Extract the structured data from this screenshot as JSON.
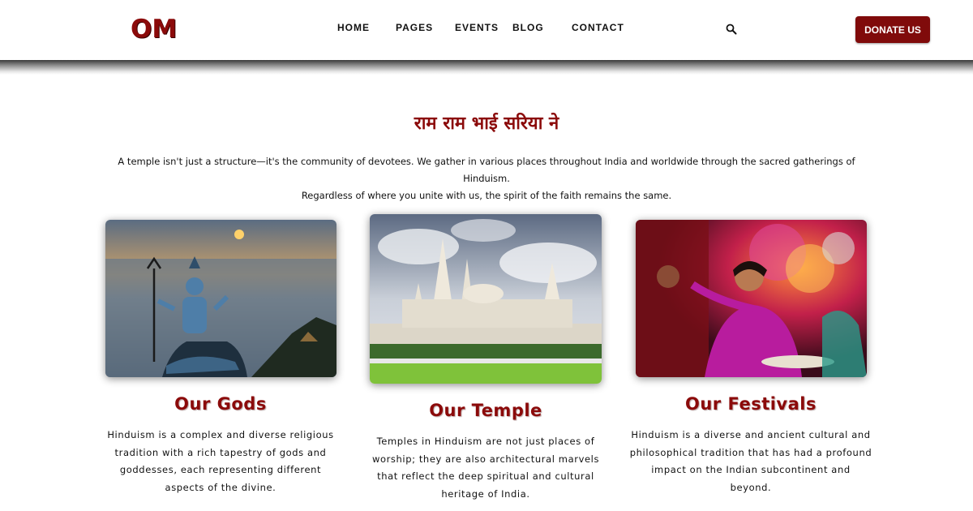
{
  "header": {
    "logo": "OM",
    "nav": [
      "HOME",
      "PAGES",
      "EVENTS",
      "BLOG",
      "CONTACT"
    ],
    "search_icon": "search-icon",
    "donate_label": "DONATE US",
    "brand_color": "#800b0b"
  },
  "intro": {
    "title": "राम राम भाई सरिया ने",
    "line1": "A temple isn't just a structure—it's the community of devotees. We gather in various places throughout India and worldwide through the sacred gatherings of Hinduism.",
    "line2": "Regardless of where you unite with us, the spirit of the faith remains the same."
  },
  "cards": [
    {
      "title": "Our Gods",
      "desc": "Hinduism is a complex and diverse religious tradition with a rich tapestry of gods and goddesses, each representing different aspects of the divine."
    },
    {
      "title": "Our Temple",
      "desc": "Temples in Hinduism are not just places of worship; they are also architectural marvels that reflect the deep spiritual and cultural heritage of India."
    },
    {
      "title": "Our Festivals",
      "desc": "Hinduism is a diverse and ancient cultural and philosophical tradition that has had a profound impact on the Indian subcontinent and beyond."
    }
  ]
}
